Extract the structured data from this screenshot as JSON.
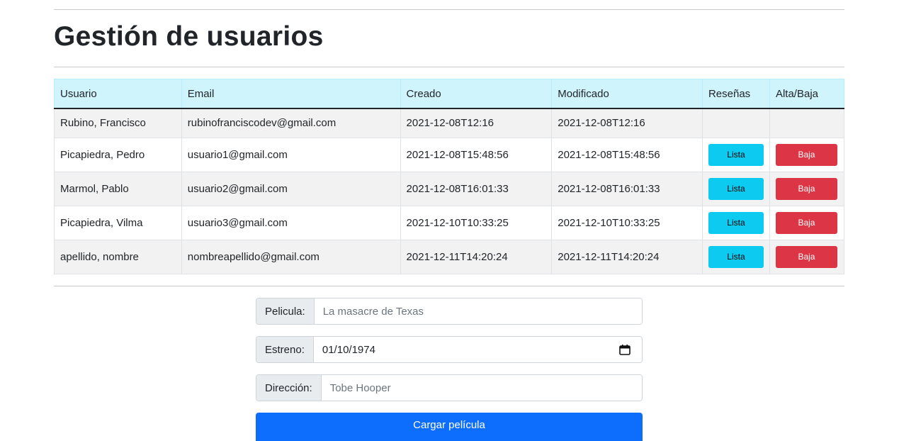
{
  "page": {
    "title": "Gestión de usuarios"
  },
  "table": {
    "headers": [
      "Usuario",
      "Email",
      "Creado",
      "Modificado",
      "Reseñas",
      "Alta/Baja"
    ],
    "rows": [
      {
        "usuario": "Rubino, Francisco",
        "email": "rubinofranciscodev@gmail.com",
        "creado": "2021-12-08T12:16",
        "modificado": "2021-12-08T12:16",
        "resenas": "",
        "alta_baja": ""
      },
      {
        "usuario": "Picapiedra, Pedro",
        "email": "usuario1@gmail.com",
        "creado": "2021-12-08T15:48:56",
        "modificado": "2021-12-08T15:48:56",
        "resenas": "Lista",
        "alta_baja": "Baja"
      },
      {
        "usuario": "Marmol, Pablo",
        "email": "usuario2@gmail.com",
        "creado": "2021-12-08T16:01:33",
        "modificado": "2021-12-08T16:01:33",
        "resenas": "Lista",
        "alta_baja": "Baja"
      },
      {
        "usuario": "Picapiedra, Vilma",
        "email": "usuario3@gmail.com",
        "creado": "2021-12-10T10:33:25",
        "modificado": "2021-12-10T10:33:25",
        "resenas": "Lista",
        "alta_baja": "Baja"
      },
      {
        "usuario": "apellido, nombre",
        "email": "nombreapellido@gmail.com",
        "creado": "2021-12-11T14:20:24",
        "modificado": "2021-12-11T14:20:24",
        "resenas": "Lista",
        "alta_baja": "Baja"
      }
    ]
  },
  "form": {
    "pelicula": {
      "label": "Pelicula:",
      "placeholder": "La masacre de Texas",
      "value": ""
    },
    "estreno": {
      "label": "Estreno:",
      "value": "01/10/1974",
      "icon": "calendar-icon"
    },
    "direccion": {
      "label": "Dirección:",
      "placeholder": "Tobe Hooper",
      "value": ""
    },
    "submit_label": "Cargar película"
  },
  "colors": {
    "header_bg": "#cff4fc",
    "info_button": "#0dcaf0",
    "danger_button": "#dc3545",
    "primary_button": "#0d6efd"
  }
}
